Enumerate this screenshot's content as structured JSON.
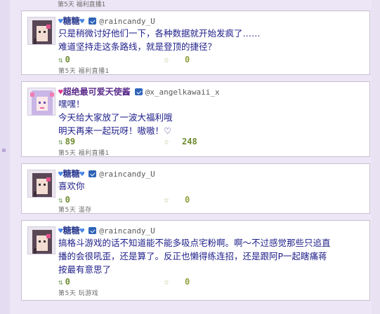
{
  "top_meta": "第5天 福利直播1",
  "posts": [
    {
      "name": "糖糖",
      "handle": "@raincandy_U",
      "lines": [
        "只是稍微讨好他们一下，各种数据就开始发疯了……",
        "难道坚持走这条路线，就是登顶的捷径？"
      ],
      "retweets": "0",
      "likes": "0",
      "meta": "第5天 福利直播1",
      "avatar_icon": "ame-avatar-icon"
    },
    {
      "name": "超绝最可爱天使酱",
      "handle": "@x_angelkawaii_x",
      "lines": [
        "嘿嘿！",
        "今天给大家放了一波大福利哦",
        "明天再来一起玩呀！嗷嗷！♡"
      ],
      "retweets": "89",
      "likes": "248",
      "meta": "第5天 福利直播1",
      "avatar_icon": "kangel-avatar-icon"
    },
    {
      "name": "糖糖",
      "handle": "@raincandy_U",
      "lines": [
        "喜欢你"
      ],
      "retweets": "0",
      "likes": "0",
      "meta": "第5天 温存",
      "avatar_icon": "ame-avatar-icon"
    },
    {
      "name": "糖糖",
      "handle": "@raincandy_U",
      "lines": [
        "搞格斗游戏的话不知道能不能多吸点宅粉啊。啊～不过感觉那些只追直",
        "播的会很吼歪，还是算了。反正也懒得练连招，还是跟阿P一起瞎痛蒋",
        "按最有意思了"
      ],
      "retweets": "0",
      "likes": "0",
      "meta": "第5天 玩游戏",
      "avatar_icon": "ame-avatar-icon"
    }
  ],
  "colors": {
    "background": "#ede6f6",
    "name": "#2b3a8f",
    "text": "#1e1e8a",
    "count": "#6e8b2e"
  }
}
